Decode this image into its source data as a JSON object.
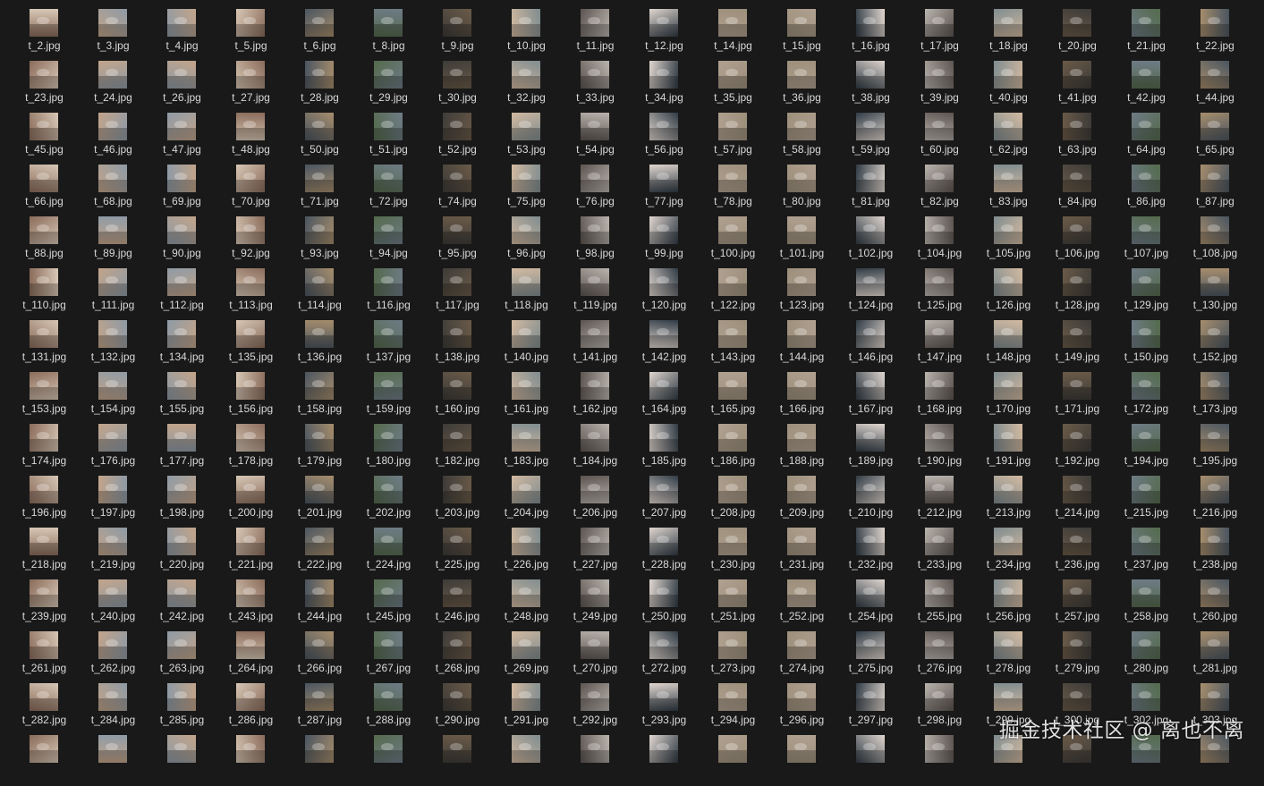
{
  "colors": {
    "background": "#191919",
    "label": "#d8d8d8",
    "thumbnail_palette": [
      "#8a6b5a",
      "#b9b3ad",
      "#5c5450",
      "#d7c7b5",
      "#6e7b86",
      "#9c8f7a",
      "#3d3b38",
      "#c2a48a",
      "#7f8c8f",
      "#e0d6cf",
      "#4a5560",
      "#a68d6c",
      "#2f3a44",
      "#d2b9a0",
      "#8e9aa5",
      "#6a5a48",
      "#b0a090",
      "#546a4c"
    ]
  },
  "files": [
    "t_2.jpg",
    "t_3.jpg",
    "t_4.jpg",
    "t_5.jpg",
    "t_6.jpg",
    "t_8.jpg",
    "t_9.jpg",
    "t_10.jpg",
    "t_11.jpg",
    "t_12.jpg",
    "t_14.jpg",
    "t_15.jpg",
    "t_16.jpg",
    "t_17.jpg",
    "t_18.jpg",
    "t_20.jpg",
    "t_21.jpg",
    "t_22.jpg",
    "t_23.jpg",
    "t_24.jpg",
    "t_26.jpg",
    "t_27.jpg",
    "t_28.jpg",
    "t_29.jpg",
    "t_30.jpg",
    "t_32.jpg",
    "t_33.jpg",
    "t_34.jpg",
    "t_35.jpg",
    "t_36.jpg",
    "t_38.jpg",
    "t_39.jpg",
    "t_40.jpg",
    "t_41.jpg",
    "t_42.jpg",
    "t_44.jpg",
    "t_45.jpg",
    "t_46.jpg",
    "t_47.jpg",
    "t_48.jpg",
    "t_50.jpg",
    "t_51.jpg",
    "t_52.jpg",
    "t_53.jpg",
    "t_54.jpg",
    "t_56.jpg",
    "t_57.jpg",
    "t_58.jpg",
    "t_59.jpg",
    "t_60.jpg",
    "t_62.jpg",
    "t_63.jpg",
    "t_64.jpg",
    "t_65.jpg",
    "t_66.jpg",
    "t_68.jpg",
    "t_69.jpg",
    "t_70.jpg",
    "t_71.jpg",
    "t_72.jpg",
    "t_74.jpg",
    "t_75.jpg",
    "t_76.jpg",
    "t_77.jpg",
    "t_78.jpg",
    "t_80.jpg",
    "t_81.jpg",
    "t_82.jpg",
    "t_83.jpg",
    "t_84.jpg",
    "t_86.jpg",
    "t_87.jpg",
    "t_88.jpg",
    "t_89.jpg",
    "t_90.jpg",
    "t_92.jpg",
    "t_93.jpg",
    "t_94.jpg",
    "t_95.jpg",
    "t_96.jpg",
    "t_98.jpg",
    "t_99.jpg",
    "t_100.jpg",
    "t_101.jpg",
    "t_102.jpg",
    "t_104.jpg",
    "t_105.jpg",
    "t_106.jpg",
    "t_107.jpg",
    "t_108.jpg",
    "t_110.jpg",
    "t_111.jpg",
    "t_112.jpg",
    "t_113.jpg",
    "t_114.jpg",
    "t_116.jpg",
    "t_117.jpg",
    "t_118.jpg",
    "t_119.jpg",
    "t_120.jpg",
    "t_122.jpg",
    "t_123.jpg",
    "t_124.jpg",
    "t_125.jpg",
    "t_126.jpg",
    "t_128.jpg",
    "t_129.jpg",
    "t_130.jpg",
    "t_131.jpg",
    "t_132.jpg",
    "t_134.jpg",
    "t_135.jpg",
    "t_136.jpg",
    "t_137.jpg",
    "t_138.jpg",
    "t_140.jpg",
    "t_141.jpg",
    "t_142.jpg",
    "t_143.jpg",
    "t_144.jpg",
    "t_146.jpg",
    "t_147.jpg",
    "t_148.jpg",
    "t_149.jpg",
    "t_150.jpg",
    "t_152.jpg",
    "t_153.jpg",
    "t_154.jpg",
    "t_155.jpg",
    "t_156.jpg",
    "t_158.jpg",
    "t_159.jpg",
    "t_160.jpg",
    "t_161.jpg",
    "t_162.jpg",
    "t_164.jpg",
    "t_165.jpg",
    "t_166.jpg",
    "t_167.jpg",
    "t_168.jpg",
    "t_170.jpg",
    "t_171.jpg",
    "t_172.jpg",
    "t_173.jpg",
    "t_174.jpg",
    "t_176.jpg",
    "t_177.jpg",
    "t_178.jpg",
    "t_179.jpg",
    "t_180.jpg",
    "t_182.jpg",
    "t_183.jpg",
    "t_184.jpg",
    "t_185.jpg",
    "t_186.jpg",
    "t_188.jpg",
    "t_189.jpg",
    "t_190.jpg",
    "t_191.jpg",
    "t_192.jpg",
    "t_194.jpg",
    "t_195.jpg",
    "t_196.jpg",
    "t_197.jpg",
    "t_198.jpg",
    "t_200.jpg",
    "t_201.jpg",
    "t_202.jpg",
    "t_203.jpg",
    "t_204.jpg",
    "t_206.jpg",
    "t_207.jpg",
    "t_208.jpg",
    "t_209.jpg",
    "t_210.jpg",
    "t_212.jpg",
    "t_213.jpg",
    "t_214.jpg",
    "t_215.jpg",
    "t_216.jpg",
    "t_218.jpg",
    "t_219.jpg",
    "t_220.jpg",
    "t_221.jpg",
    "t_222.jpg",
    "t_224.jpg",
    "t_225.jpg",
    "t_226.jpg",
    "t_227.jpg",
    "t_228.jpg",
    "t_230.jpg",
    "t_231.jpg",
    "t_232.jpg",
    "t_233.jpg",
    "t_234.jpg",
    "t_236.jpg",
    "t_237.jpg",
    "t_238.jpg",
    "t_239.jpg",
    "t_240.jpg",
    "t_242.jpg",
    "t_243.jpg",
    "t_244.jpg",
    "t_245.jpg",
    "t_246.jpg",
    "t_248.jpg",
    "t_249.jpg",
    "t_250.jpg",
    "t_251.jpg",
    "t_252.jpg",
    "t_254.jpg",
    "t_255.jpg",
    "t_256.jpg",
    "t_257.jpg",
    "t_258.jpg",
    "t_260.jpg",
    "t_261.jpg",
    "t_262.jpg",
    "t_263.jpg",
    "t_264.jpg",
    "t_266.jpg",
    "t_267.jpg",
    "t_268.jpg",
    "t_269.jpg",
    "t_270.jpg",
    "t_272.jpg",
    "t_273.jpg",
    "t_274.jpg",
    "t_275.jpg",
    "t_276.jpg",
    "t_278.jpg",
    "t_279.jpg",
    "t_280.jpg",
    "t_281.jpg",
    "t_282.jpg",
    "t_284.jpg",
    "t_285.jpg",
    "t_286.jpg",
    "t_287.jpg",
    "t_288.jpg",
    "t_290.jpg",
    "t_291.jpg",
    "t_292.jpg",
    "t_293.jpg",
    "t_294.jpg",
    "t_296.jpg",
    "t_297.jpg",
    "t_298.jpg",
    "t_299.jpg",
    "t_300.jpg",
    "t_302.jpg",
    "t_303.jpg",
    "",
    "",
    "",
    "",
    "",
    "",
    "",
    "",
    "",
    "",
    "",
    "",
    "",
    "",
    "",
    "",
    "",
    ""
  ],
  "watermark": "掘金技术社区 @ 离也不离"
}
